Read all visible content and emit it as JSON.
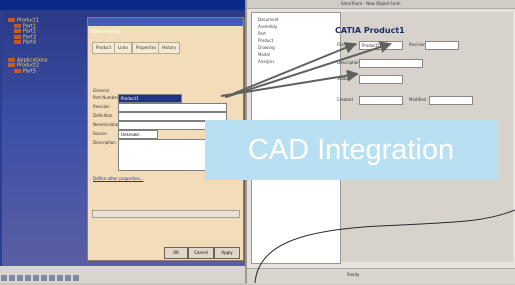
{
  "left_app": {
    "tree_items": [
      "Product1",
      "Part1",
      "Part2",
      "Part3",
      "Part4",
      "Applications",
      "Product2",
      "Part5"
    ],
    "dialog": {
      "title": "Save dialog",
      "tabs": [
        "Product",
        "Links",
        "Properties",
        "History"
      ],
      "section_label": "General",
      "fields": [
        {
          "label": "Part Number",
          "value": "Product1",
          "selected": true
        },
        {
          "label": "Revision",
          "value": ""
        },
        {
          "label": "Definition",
          "value": ""
        },
        {
          "label": "Nomenclature",
          "value": ""
        },
        {
          "label": "Source",
          "value": "Unknown"
        },
        {
          "label": "Description",
          "value": ""
        }
      ],
      "link_text": "Define other properties...",
      "buttons": [
        "OK",
        "Cancel",
        "Apply"
      ]
    }
  },
  "right_app": {
    "title": "SmarTeam - New Object Form",
    "form_title": "CATIA Product1",
    "tree_items": [
      "Document",
      "Assembly",
      "Part",
      "Product",
      "Drawing",
      "Model",
      "Analysis"
    ],
    "fields": [
      {
        "label": "File Name",
        "value": "Product1"
      },
      {
        "label": "Revision",
        "value": ""
      },
      {
        "label": "Description",
        "value": ""
      },
      {
        "label": "Status",
        "value": ""
      },
      {
        "label": "Created",
        "value": ""
      },
      {
        "label": "Modified",
        "value": ""
      }
    ],
    "status_text": "Ready"
  },
  "caption": "CAD Integration",
  "colors": {
    "caption_bg": "#b8dff2",
    "arrow": "#606060",
    "dialog_bg": "#f3dcb9",
    "cad_bg": "#2d3f8e"
  }
}
